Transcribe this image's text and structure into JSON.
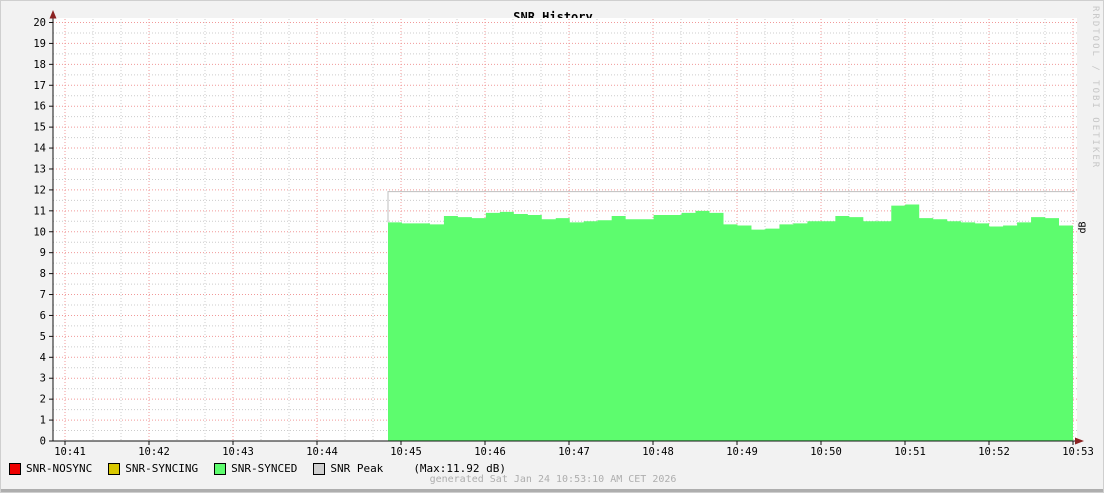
{
  "title": "SNR History",
  "credit": "RRDTOOL / TOBI OETIKER",
  "right_axis_label": "dB",
  "footer": "generated Sat Jan 24 10:53:10 AM CET 2026",
  "legend": [
    {
      "label": "SNR-NOSYNC",
      "color": "#ee0000"
    },
    {
      "label": "SNR-SYNCING",
      "color": "#d9c800"
    },
    {
      "label": "SNR-SYNCED",
      "color": "#5dfc6e"
    },
    {
      "label": "SNR Peak",
      "color": "#cfcfcf",
      "extra": "(Max:11.92 dB)"
    }
  ],
  "colors": {
    "background": "#f2f2f2",
    "plot_background": "#ffffff",
    "major_grid": "#f19999",
    "minor_grid": "#cccccc",
    "axis": "#111111",
    "arrow": "#8b2222",
    "area": "#5dfc6e",
    "peak_line": "#bfbfbf"
  },
  "chart_data": {
    "type": "area",
    "title": "SNR History",
    "ylabel_right": "dB",
    "ylim": [
      0,
      20
    ],
    "y_tick_step": 1,
    "y_minor_step": 0.5,
    "grid": true,
    "x_tick_labels": [
      "10:41",
      "10:42",
      "10:43",
      "10:44",
      "10:45",
      "10:46",
      "10:47",
      "10:48",
      "10:49",
      "10:50",
      "10:51",
      "10:52",
      "10:53"
    ],
    "x_minor_per_major": 3,
    "series": [
      {
        "name": "SNR-SYNCED",
        "type": "area",
        "color": "#5dfc6e",
        "start": "10:44:50",
        "end": "10:53:00",
        "step_seconds": 10,
        "unit": "dB",
        "values": [
          10.45,
          10.4,
          10.4,
          10.35,
          10.75,
          10.7,
          10.65,
          10.9,
          10.95,
          10.85,
          10.8,
          10.6,
          10.65,
          10.45,
          10.5,
          10.55,
          10.75,
          10.6,
          10.6,
          10.8,
          10.8,
          10.9,
          11.0,
          10.9,
          10.35,
          10.3,
          10.1,
          10.15,
          10.35,
          10.4,
          10.5,
          10.5,
          10.75,
          10.7,
          10.5,
          10.5,
          11.25,
          11.3,
          10.65,
          10.6,
          10.5,
          10.45,
          10.4,
          10.25,
          10.3,
          10.45,
          10.7,
          10.65,
          10.3
        ]
      },
      {
        "name": "SNR Peak",
        "type": "line",
        "color": "#bfbfbf",
        "value": 11.92,
        "max_label": "Max:11.92 dB"
      },
      {
        "name": "SNR-NOSYNC",
        "type": "area",
        "color": "#ee0000",
        "values": []
      },
      {
        "name": "SNR-SYNCING",
        "type": "area",
        "color": "#d9c800",
        "values": []
      }
    ],
    "legend_position": "bottom"
  }
}
